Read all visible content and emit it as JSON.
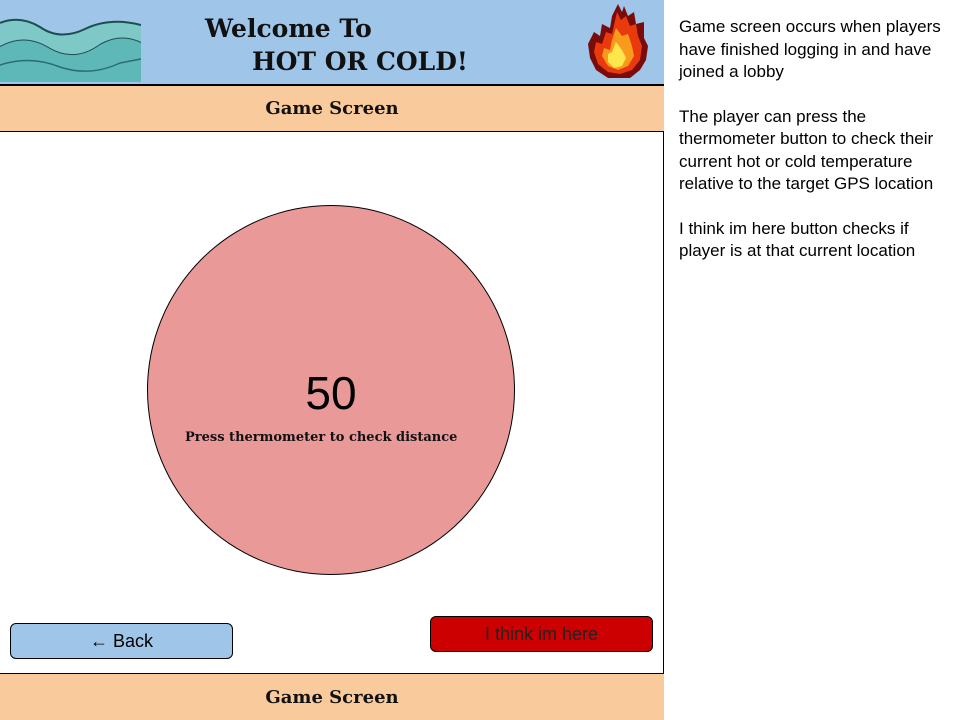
{
  "header": {
    "title_line1": "Welcome To",
    "title_line2": "HOT OR COLD!"
  },
  "top_bar": {
    "label": "Game Screen"
  },
  "thermometer": {
    "value": "50",
    "hint": "Press thermometer to check distance"
  },
  "buttons": {
    "back_label": "← Back",
    "here_label": "I think im here"
  },
  "bottom_bar": {
    "label": "Game Screen"
  },
  "notes": [
    "Game screen occurs when players have finished logging in and have joined a lobby",
    "The player can press the thermometer button to check their current hot or cold temperature relative to the target GPS location",
    "I think im here button checks if player is at that current location"
  ],
  "colors": {
    "header_bg": "#9fc5e8",
    "bar_bg": "#f9cb9c",
    "thermometer_bg": "#ea9999",
    "back_button_bg": "#9fc5e8",
    "here_button_bg": "#cc0000"
  },
  "icons": [
    "wave-icon",
    "fire-icon"
  ]
}
